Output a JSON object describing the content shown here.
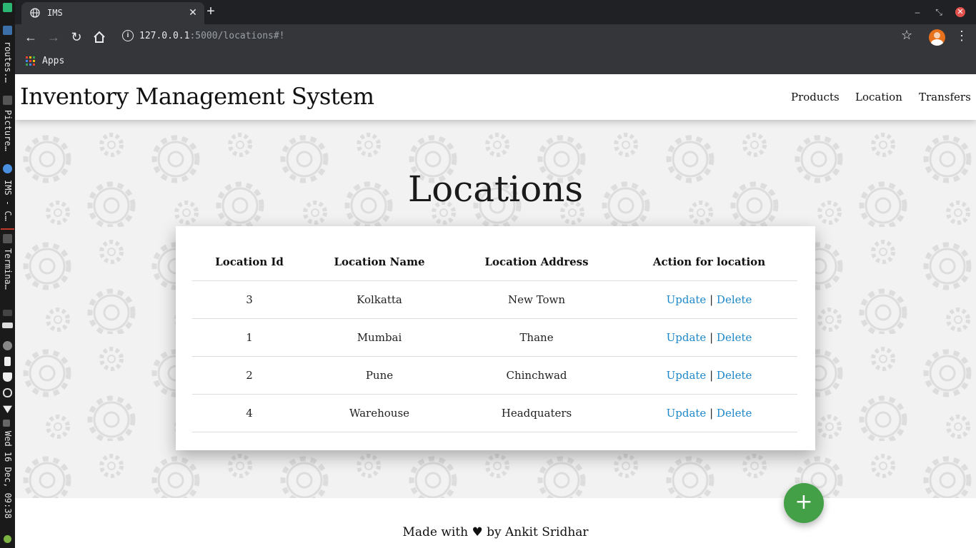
{
  "taskbar": {
    "items": [
      "routes.…",
      "Picture…",
      "IMS - C…",
      "Termina…"
    ],
    "clock": "Wed 16 Dec, 09:38"
  },
  "browser": {
    "tab_title": "IMS",
    "url_host": "127.0.0.1",
    "url_rest": ":5000/locations#!",
    "bookmarks_apps": "Apps"
  },
  "navbar": {
    "brand": "Inventory Management System",
    "links": [
      "Products",
      "Location",
      "Transfers"
    ]
  },
  "main": {
    "heading": "Locations",
    "table": {
      "headers": [
        "Location Id",
        "Location Name",
        "Location Address",
        "Action for location"
      ],
      "rows": [
        {
          "id": "3",
          "name": "Kolkatta",
          "address": "New Town"
        },
        {
          "id": "1",
          "name": "Mumbai",
          "address": "Thane"
        },
        {
          "id": "2",
          "name": "Pune",
          "address": "Chinchwad"
        },
        {
          "id": "4",
          "name": "Warehouse",
          "address": "Headquaters"
        }
      ],
      "update_label": "Update",
      "separator": "|",
      "delete_label": "Delete"
    },
    "fab_label": "+"
  },
  "footer": {
    "text": "Made with ♥ by Ankit Sridhar"
  },
  "colors": {
    "link": "#1e88c9",
    "fab": "#43a047",
    "browser_dark": "#202124"
  }
}
